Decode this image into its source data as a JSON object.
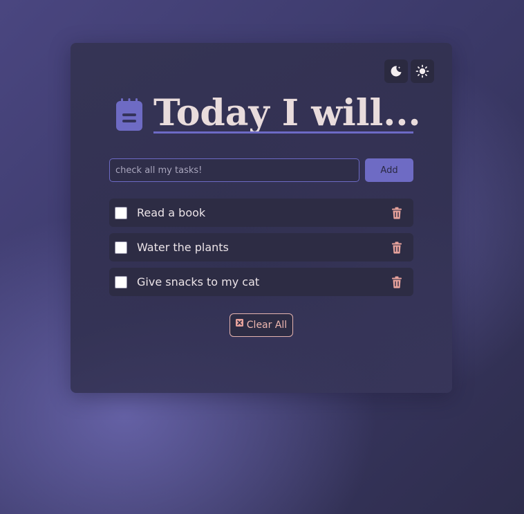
{
  "header": {
    "title": "Today I will..."
  },
  "theme": {
    "dark_icon": "moon-icon",
    "light_icon": "sun-icon"
  },
  "new_task": {
    "placeholder": "check all my tasks!",
    "value": "",
    "add_label": "Add"
  },
  "tasks": [
    {
      "label": "Read a book",
      "checked": false
    },
    {
      "label": "Water the plants",
      "checked": false
    },
    {
      "label": "Give snacks to my cat",
      "checked": false
    }
  ],
  "actions": {
    "clear_all_label": "Clear All"
  },
  "colors": {
    "accent": "#6e6bc4",
    "delete": "#e7a29c",
    "title_text": "#e9dcdc"
  }
}
